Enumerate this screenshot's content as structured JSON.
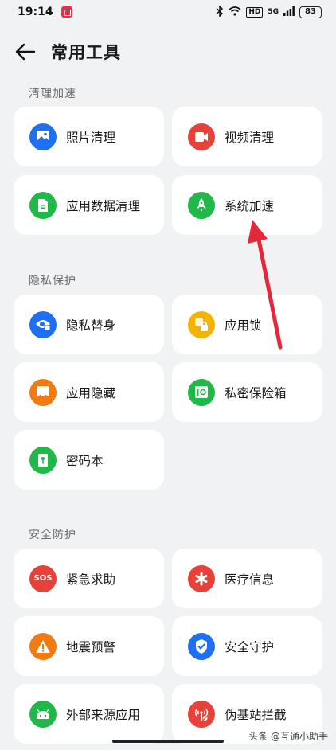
{
  "status_bar": {
    "time": "19:14",
    "hd_label": "HD",
    "signal_label": "5G",
    "battery": "83"
  },
  "header": {
    "back_icon": "arrow-left-icon",
    "title": "常用工具"
  },
  "sections": [
    {
      "label": "清理加速",
      "items": [
        {
          "label": "照片清理",
          "icon": "photo-icon",
          "color": "#1e6ff1"
        },
        {
          "label": "视频清理",
          "icon": "video-icon",
          "color": "#e8413a"
        },
        {
          "label": "应用数据清理",
          "icon": "document-icon",
          "color": "#21b84a"
        },
        {
          "label": "系统加速",
          "icon": "rocket-icon",
          "color": "#21b84a"
        }
      ]
    },
    {
      "label": "隐私保护",
      "items": [
        {
          "label": "隐私替身",
          "icon": "eye-lock-icon",
          "color": "#1e6ff1"
        },
        {
          "label": "应用锁",
          "icon": "lock-icon",
          "color": "#f5b301"
        },
        {
          "label": "应用隐藏",
          "icon": "hidden-app-icon",
          "color": "#f27a12"
        },
        {
          "label": "私密保险箱",
          "icon": "safe-icon",
          "color": "#21b84a"
        },
        {
          "label": "密码本",
          "icon": "key-icon",
          "color": "#21b84a"
        }
      ]
    },
    {
      "label": "安全防护",
      "items": [
        {
          "label": "紧急求助",
          "icon": "sos-icon",
          "color": "#e8413a",
          "icon_text": "SOS"
        },
        {
          "label": "医疗信息",
          "icon": "asterisk-icon",
          "color": "#e8413a"
        },
        {
          "label": "地震预警",
          "icon": "warning-icon",
          "color": "#f27a12"
        },
        {
          "label": "安全守护",
          "icon": "shield-icon",
          "color": "#1e6ff1"
        },
        {
          "label": "外部来源应用",
          "icon": "android-icon",
          "color": "#21b84a"
        },
        {
          "label": "伪基站拦截",
          "icon": "antenna-block-icon",
          "color": "#e8413a"
        }
      ]
    }
  ],
  "watermark": "头条 @互通小助手",
  "annotation": {
    "color": "#e5273a"
  }
}
